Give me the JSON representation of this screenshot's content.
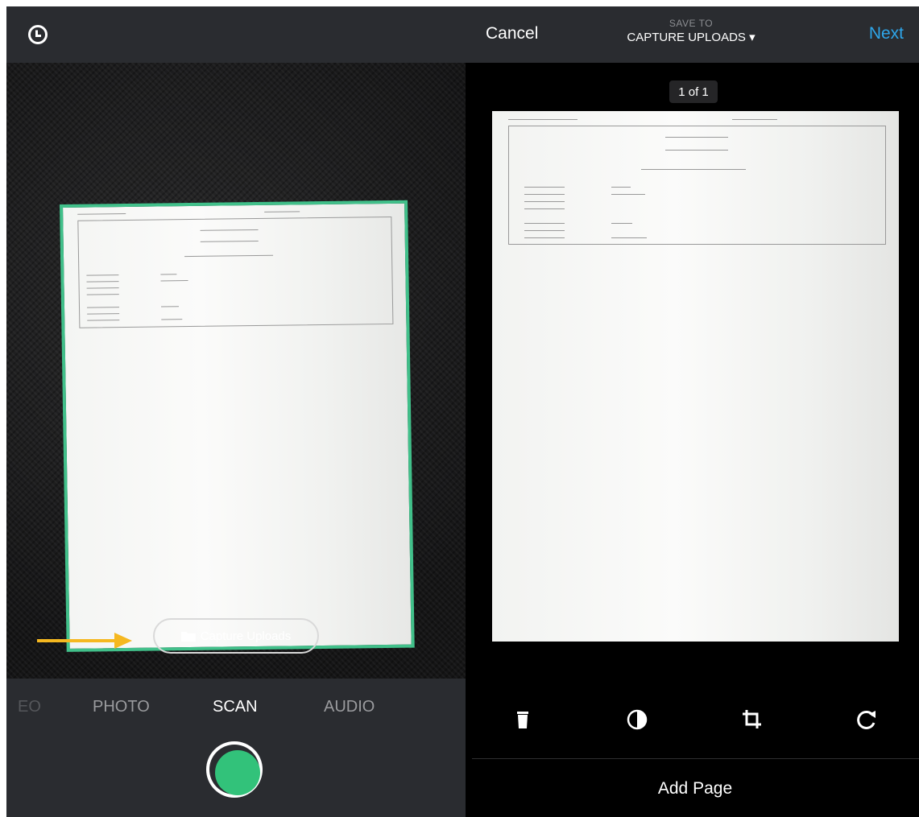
{
  "left_panel": {
    "history_icon": "clock-history-icon",
    "destination_pill": {
      "icon": "folder-icon",
      "label": "Capture Uploads"
    },
    "arrow_color": "#f5b820",
    "modes": [
      {
        "label": "EO",
        "active": false
      },
      {
        "label": "PHOTO",
        "active": false
      },
      {
        "label": "SCAN",
        "active": true
      },
      {
        "label": "AUDIO",
        "active": false
      }
    ],
    "shutter_color": "#32c27a",
    "scan_outline_color": "#41c08a"
  },
  "right_panel": {
    "cancel_label": "Cancel",
    "save_to_label": "SAVE TO",
    "save_to_destination": "CAPTURE UPLOADS ▾",
    "next_label": "Next",
    "page_counter": "1 of 1",
    "tools": [
      {
        "icon": "trash-icon"
      },
      {
        "icon": "contrast-icon"
      },
      {
        "icon": "crop-icon"
      },
      {
        "icon": "rotate-icon"
      }
    ],
    "add_page_label": "Add Page"
  },
  "colors": {
    "accent_blue": "#2ea6ea",
    "bar_background": "#2a2c30"
  }
}
